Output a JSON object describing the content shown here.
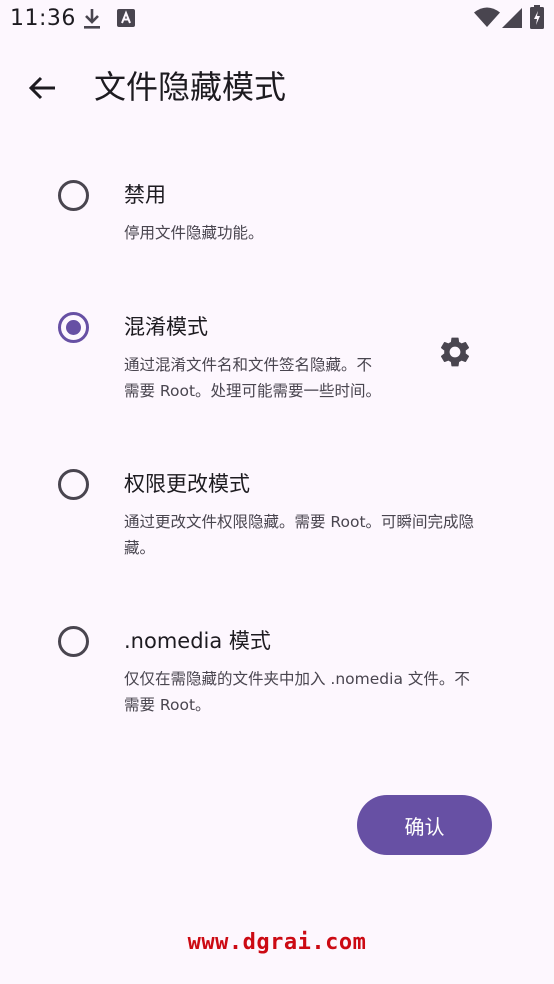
{
  "status_bar": {
    "time": "11:36",
    "icons": [
      "download-icon",
      "font-a-icon",
      "wifi-icon",
      "signal-icon",
      "battery-icon"
    ]
  },
  "app_bar": {
    "back_icon": "arrow-back-icon",
    "title": "文件隐藏模式"
  },
  "options": [
    {
      "title": "禁用",
      "description": "停用文件隐藏功能。",
      "selected": false
    },
    {
      "title": "混淆模式",
      "description": "通过混淆文件名和文件签名隐藏。不\n需要 Root。处理可能需要一些时间。",
      "selected": true,
      "settings_icon": "gear-icon"
    },
    {
      "title": "权限更改模式",
      "description": "通过更改文件权限隐藏。需要 Root。可瞬间完成隐\n藏。",
      "selected": false
    },
    {
      "title": ".nomedia 模式",
      "description": "仅仅在需隐藏的文件夹中加入 .nomedia 文件。不\n需要 Root。",
      "selected": false
    }
  ],
  "confirm_button": {
    "label": "确认"
  },
  "watermark": "www.dgrai.com",
  "colors": {
    "background": "#fdf7fe",
    "accent": "#6750a4",
    "text_primary": "#1d1b20",
    "text_secondary": "#49454f",
    "watermark": "#cc0a13"
  }
}
